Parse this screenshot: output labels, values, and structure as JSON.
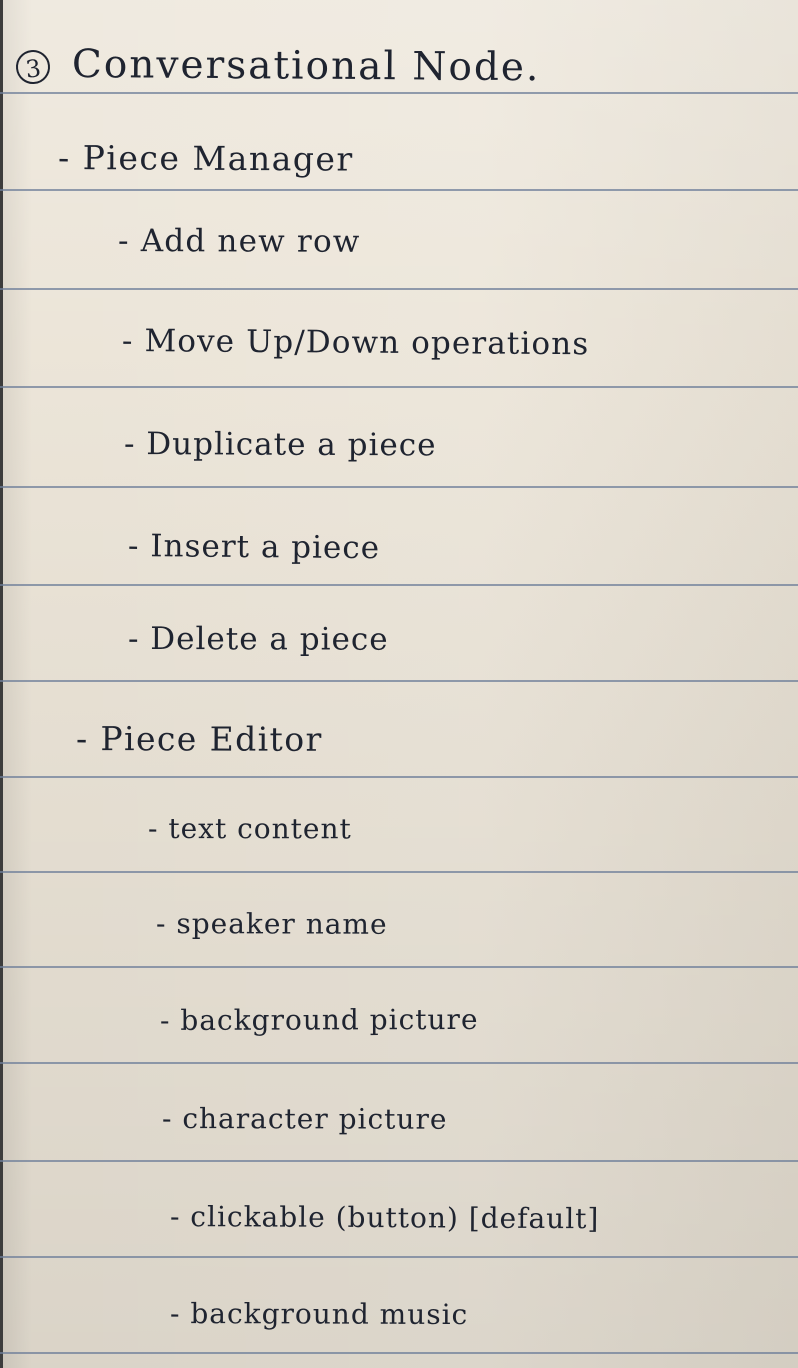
{
  "page": {
    "title_number": "3",
    "title_text": "Conversational Node.",
    "sections": [
      {
        "label": "- Piece Manager",
        "items": [
          "- Add new row",
          "- Move Up/Down operations",
          "- Duplicate a piece",
          "- Insert a piece",
          "- Delete a piece"
        ]
      },
      {
        "label": "- Piece Editor",
        "items": [
          "- text content",
          "- speaker name",
          "- background picture",
          "- character picture",
          "- clickable (button) [default]",
          "- background music"
        ]
      }
    ]
  }
}
